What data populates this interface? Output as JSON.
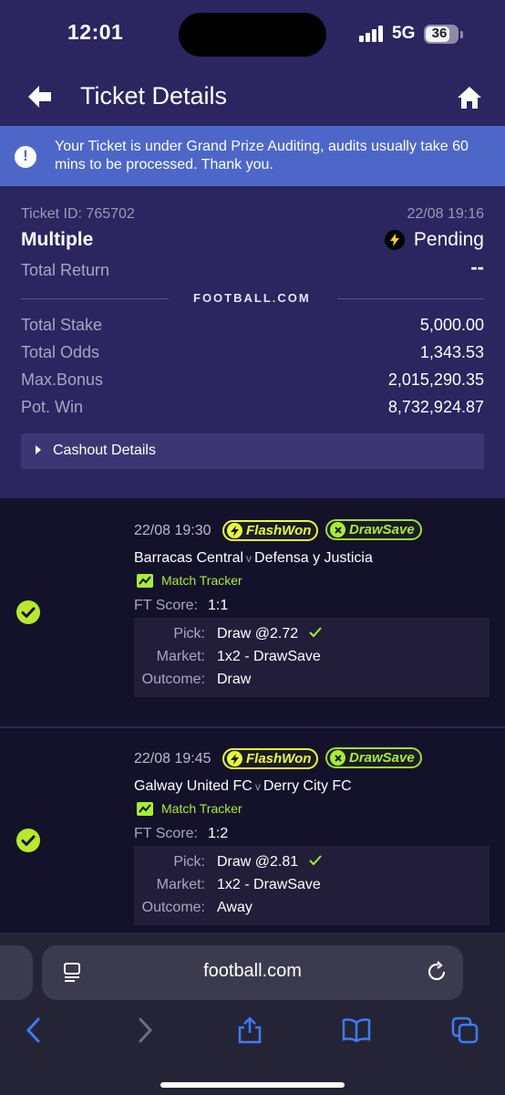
{
  "status_bar": {
    "time": "12:01",
    "network": "5G",
    "battery": "36"
  },
  "header": {
    "title": "Ticket Details",
    "back_icon": "arrow-left-icon",
    "home_icon": "home-icon"
  },
  "banner": {
    "text": "Your Ticket is under Grand Prize Auditing, audits usually take 60 mins to be processed. Thank you.",
    "icon": "exclamation-circle-icon"
  },
  "ticket": {
    "id_label": "Ticket ID: 765702",
    "datetime": "22/08 19:16",
    "type": "Multiple",
    "status": "Pending",
    "total_return_label": "Total Return",
    "total_return_value": "--",
    "brand_main": "FOOTBALL",
    "brand_dot": ".",
    "brand_tld": "COM",
    "stats": [
      {
        "label": "Total Stake",
        "value": "5,000.00"
      },
      {
        "label": "Total Odds",
        "value": "1,343.53"
      },
      {
        "label": "Max.Bonus",
        "value": "2,015,290.35"
      },
      {
        "label": "Pot. Win",
        "value": "8,732,924.87"
      }
    ],
    "cashout_label": "Cashout Details"
  },
  "bets": [
    {
      "datetime": "22/08 19:30",
      "tag_flash": "FlashWon",
      "tag_draw": "DrawSave",
      "home": "Barracas Central",
      "vs": "v",
      "away": "Defensa y Justicia",
      "tracker": "Match Tracker",
      "ft_label": "FT Score:",
      "ft_score": "1:1",
      "pick_label": "Pick:",
      "pick": "Draw @2.72",
      "market_label": "Market:",
      "market": "1x2 - DrawSave",
      "outcome_label": "Outcome:",
      "outcome": "Draw"
    },
    {
      "datetime": "22/08 19:45",
      "tag_flash": "FlashWon",
      "tag_draw": "DrawSave",
      "home": "Galway United FC",
      "vs": "v",
      "away": "Derry City FC",
      "tracker": "Match Tracker",
      "ft_label": "FT Score:",
      "ft_score": "1:2",
      "pick_label": "Pick:",
      "pick": "Draw @2.81",
      "market_label": "Market:",
      "market": "1x2 - DrawSave",
      "outcome_label": "Outcome:",
      "outcome": "Away"
    }
  ],
  "browser": {
    "url": "football.com"
  },
  "colors": {
    "header_bg": "#2b2560",
    "banner_bg": "#4d67c9",
    "accent_green": "#a6ef2e",
    "accent_yellow": "#e8ff32",
    "page_bg": "#14112b"
  }
}
